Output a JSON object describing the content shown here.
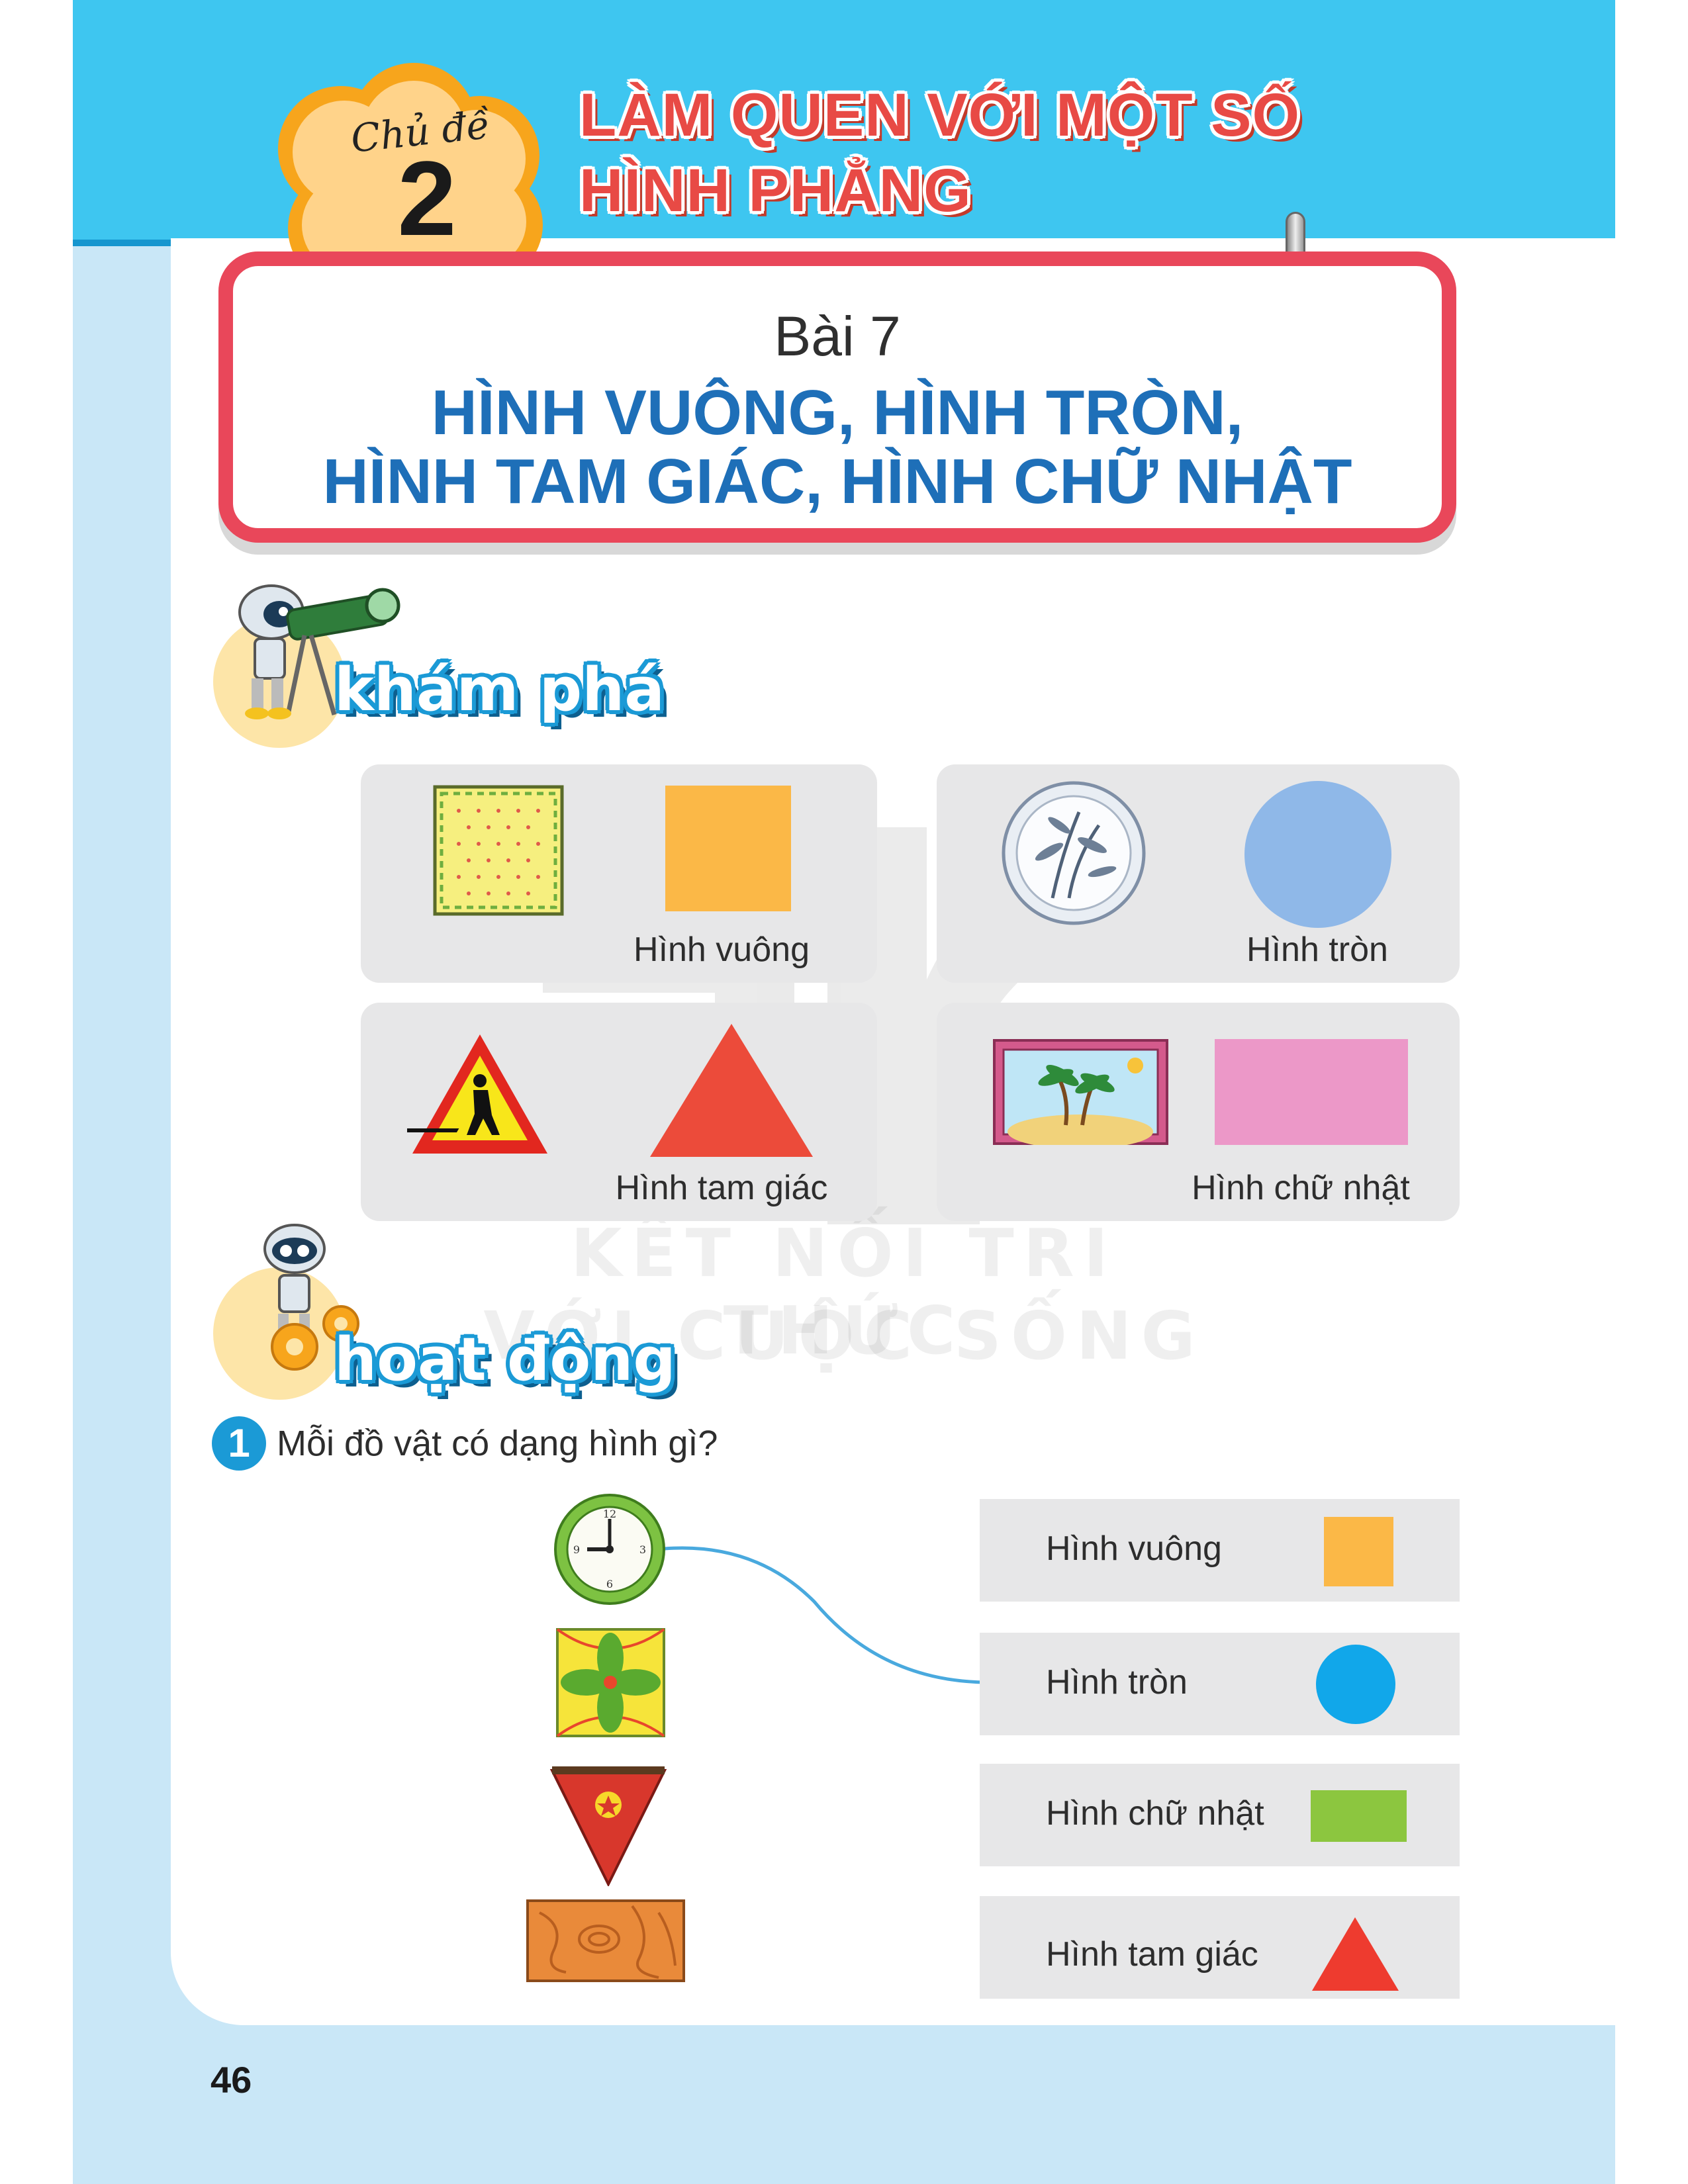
{
  "topic": {
    "label": "Chủ đề",
    "number": "2",
    "title_line1": "LÀM QUEN VỚI MỘT SỐ",
    "title_line2": "HÌNH PHẲNG"
  },
  "lesson": {
    "number": "Bài 7",
    "title_line1": "HÌNH VUÔNG, HÌNH TRÒN,",
    "title_line2": "HÌNH TAM GIÁC, HÌNH CHỮ NHẬT"
  },
  "explore": {
    "label": "khám phá",
    "cards": [
      {
        "label": "Hình vuông",
        "shape_color": "#fbb847",
        "object": "napkin-icon"
      },
      {
        "label": "Hình tròn",
        "shape_color": "#8fb8e8",
        "object": "plate-icon"
      },
      {
        "label": "Hình tam giác",
        "shape_color": "#ec4b3a",
        "object": "road-sign-icon"
      },
      {
        "label": "Hình chữ nhật",
        "shape_color": "#ec98c8",
        "object": "picture-frame-icon"
      }
    ]
  },
  "activity": {
    "label": "hoạt động",
    "exercise_number": "1",
    "question": "Mỗi đồ vật có dạng hình gì?",
    "objects": [
      "clock-icon",
      "tile-icon",
      "pennant-icon",
      "wood-board-icon"
    ],
    "options": [
      {
        "label": "Hình vuông",
        "color": "#fbb847"
      },
      {
        "label": "Hình tròn",
        "color": "#11a7ea"
      },
      {
        "label": "Hình chữ nhật",
        "color": "#8cc63f"
      },
      {
        "label": "Hình tam giác",
        "color": "#ee3b2f"
      }
    ],
    "connections": [
      {
        "from": "clock-icon",
        "to": "Hình tròn"
      }
    ]
  },
  "watermark": {
    "line1": "KẾT NỐI TRI THỨC",
    "line2": "VỚI CUỘC SỐNG"
  },
  "page_number": "46"
}
